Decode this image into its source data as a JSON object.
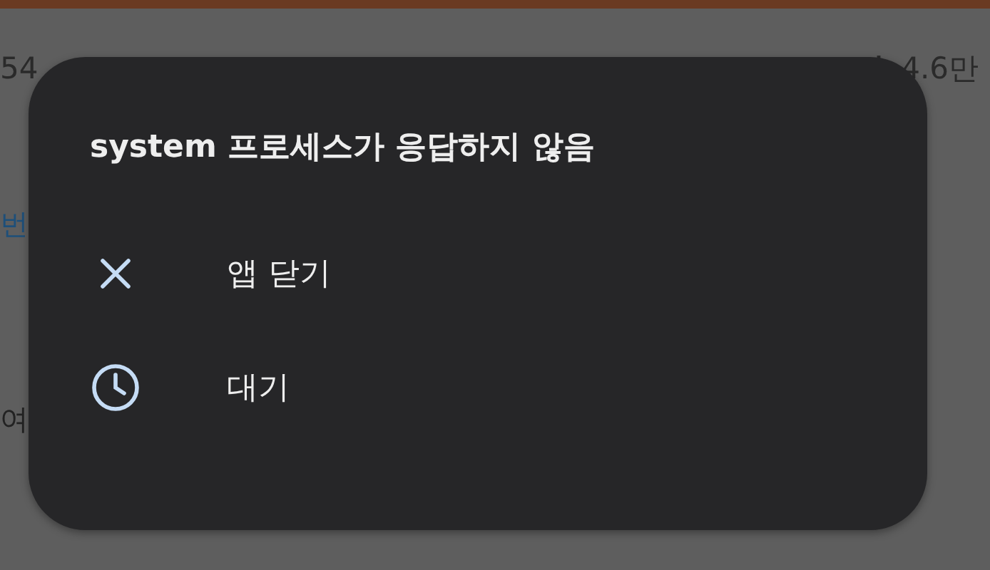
{
  "feed": {
    "stats": [
      {
        "kind": "replies",
        "text": "54"
      },
      {
        "kind": "views",
        "text": "4.6만"
      }
    ],
    "fragments": [
      {
        "kind": "link",
        "text": "번"
      },
      {
        "kind": "plain",
        "text": "여"
      }
    ]
  },
  "dialog": {
    "title": "system 프로세스가 응답하지 않음",
    "actions": [
      {
        "kind": "close",
        "label": "앱 닫기"
      },
      {
        "kind": "wait",
        "label": "대기"
      }
    ]
  }
}
